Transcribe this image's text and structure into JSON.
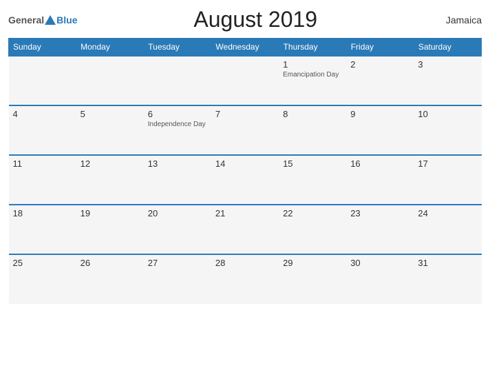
{
  "header": {
    "logo_general": "General",
    "logo_blue": "Blue",
    "title": "August 2019",
    "country": "Jamaica"
  },
  "calendar": {
    "weekdays": [
      "Sunday",
      "Monday",
      "Tuesday",
      "Wednesday",
      "Thursday",
      "Friday",
      "Saturday"
    ],
    "weeks": [
      [
        {
          "day": "",
          "holiday": ""
        },
        {
          "day": "",
          "holiday": ""
        },
        {
          "day": "",
          "holiday": ""
        },
        {
          "day": "",
          "holiday": ""
        },
        {
          "day": "1",
          "holiday": "Emancipation Day"
        },
        {
          "day": "2",
          "holiday": ""
        },
        {
          "day": "3",
          "holiday": ""
        }
      ],
      [
        {
          "day": "4",
          "holiday": ""
        },
        {
          "day": "5",
          "holiday": ""
        },
        {
          "day": "6",
          "holiday": "Independence Day"
        },
        {
          "day": "7",
          "holiday": ""
        },
        {
          "day": "8",
          "holiday": ""
        },
        {
          "day": "9",
          "holiday": ""
        },
        {
          "day": "10",
          "holiday": ""
        }
      ],
      [
        {
          "day": "11",
          "holiday": ""
        },
        {
          "day": "12",
          "holiday": ""
        },
        {
          "day": "13",
          "holiday": ""
        },
        {
          "day": "14",
          "holiday": ""
        },
        {
          "day": "15",
          "holiday": ""
        },
        {
          "day": "16",
          "holiday": ""
        },
        {
          "day": "17",
          "holiday": ""
        }
      ],
      [
        {
          "day": "18",
          "holiday": ""
        },
        {
          "day": "19",
          "holiday": ""
        },
        {
          "day": "20",
          "holiday": ""
        },
        {
          "day": "21",
          "holiday": ""
        },
        {
          "day": "22",
          "holiday": ""
        },
        {
          "day": "23",
          "holiday": ""
        },
        {
          "day": "24",
          "holiday": ""
        }
      ],
      [
        {
          "day": "25",
          "holiday": ""
        },
        {
          "day": "26",
          "holiday": ""
        },
        {
          "day": "27",
          "holiday": ""
        },
        {
          "day": "28",
          "holiday": ""
        },
        {
          "day": "29",
          "holiday": ""
        },
        {
          "day": "30",
          "holiday": ""
        },
        {
          "day": "31",
          "holiday": ""
        }
      ]
    ]
  }
}
